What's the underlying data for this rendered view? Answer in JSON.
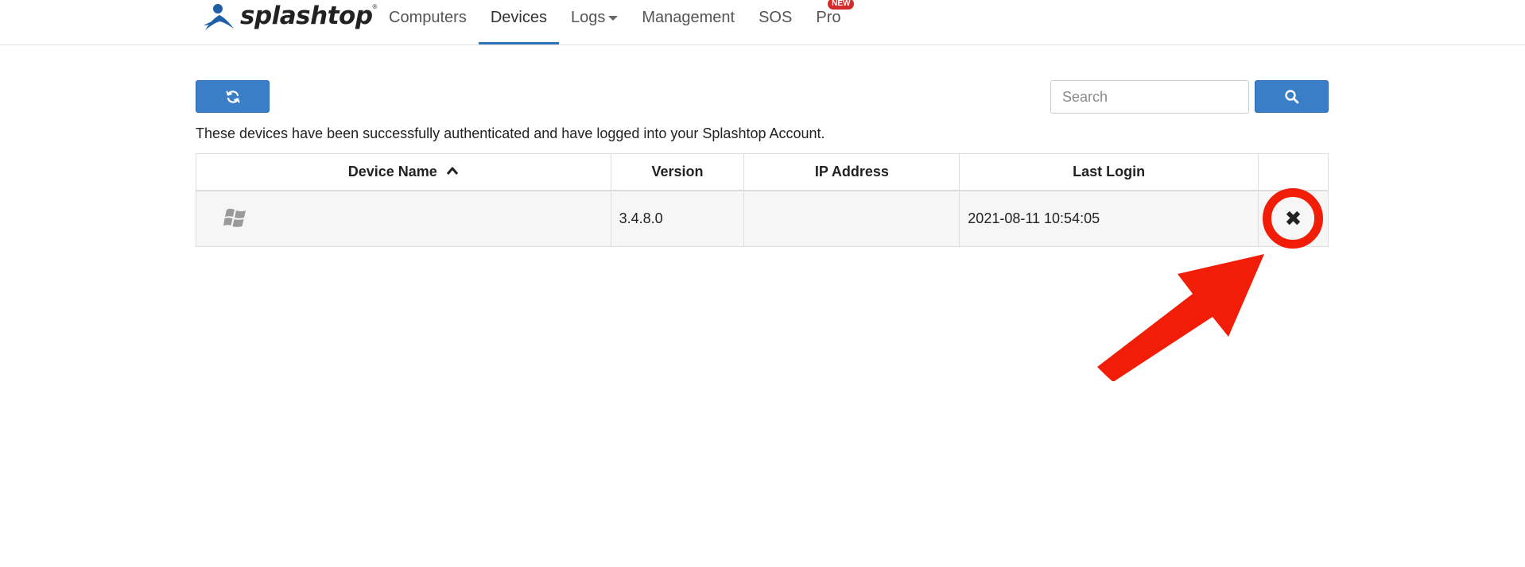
{
  "header": {
    "brand": "splashtop",
    "brand_mark": "®",
    "nav": [
      {
        "label": "Computers",
        "active": false
      },
      {
        "label": "Devices",
        "active": true
      },
      {
        "label": "Logs",
        "active": false,
        "dropdown": true
      },
      {
        "label": "Management",
        "active": false
      },
      {
        "label": "SOS",
        "active": false
      },
      {
        "label": "Pro",
        "active": false,
        "badge": "NEW"
      }
    ]
  },
  "toolbar": {
    "refresh_icon": "refresh-icon",
    "search_placeholder": "Search",
    "search_value": "",
    "search_icon": "search-icon"
  },
  "intro_text": "These devices have been successfully authenticated and have logged into your Splashtop Account.",
  "table": {
    "columns": [
      "Device Name",
      "Version",
      "IP Address",
      "Last Login",
      ""
    ],
    "sort_column": "Device Name",
    "sort_direction": "ascending",
    "rows": [
      {
        "os_icon": "windows-icon",
        "device_name": "",
        "version": "3.4.8.0",
        "ip_address": "",
        "last_login": "2021-08-11 10:54:05",
        "action_icon": "close-icon",
        "action_glyph": "✖"
      }
    ]
  },
  "annotation": {
    "highlight": "red circle around remove button",
    "color": "#f21d06"
  },
  "colors": {
    "accent": "#3a7ec8",
    "nav_underline": "#2f73b8",
    "badge": "#d42a2a"
  }
}
